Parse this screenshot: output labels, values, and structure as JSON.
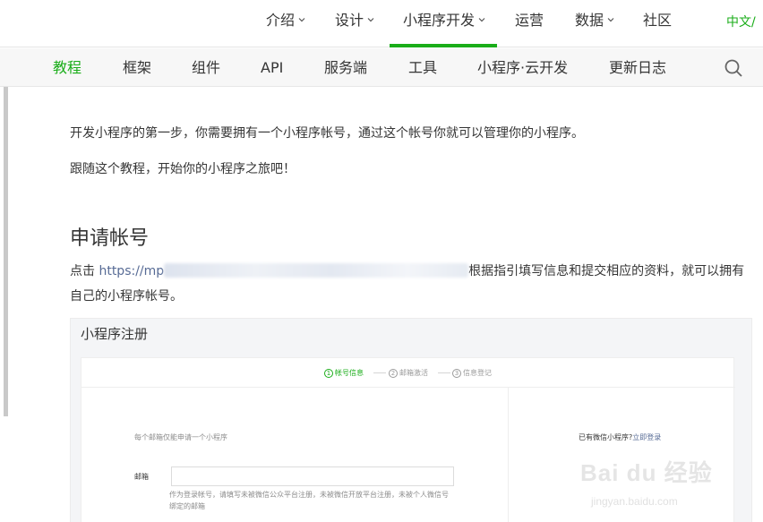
{
  "topnav": {
    "items": [
      {
        "label": "介绍",
        "has_dropdown": true
      },
      {
        "label": "设计",
        "has_dropdown": true
      },
      {
        "label": "小程序开发",
        "has_dropdown": true,
        "active": true
      },
      {
        "label": "运营",
        "has_dropdown": false
      },
      {
        "label": "数据",
        "has_dropdown": true
      },
      {
        "label": "社区",
        "has_dropdown": false
      }
    ],
    "language": "中文/",
    "accent_color": "#1aad19"
  },
  "subnav": {
    "items": [
      {
        "label": "教程",
        "active": true
      },
      {
        "label": "框架"
      },
      {
        "label": "组件"
      },
      {
        "label": "API"
      },
      {
        "label": "服务端"
      },
      {
        "label": "工具"
      },
      {
        "label": "小程序·云开发"
      },
      {
        "label": "更新日志"
      }
    ],
    "search_icon": "search-icon"
  },
  "content": {
    "intro_1": "开发小程序的第一步，你需要拥有一个小程序帐号，通过这个帐号你就可以管理你的小程序。",
    "intro_2": "跟随这个教程，开始你的小程序之旅吧！",
    "section_title": "申请帐号",
    "click_prefix": "点击 ",
    "link_visible": "https://mp",
    "after_link": "根据指引填写信息和提交相应的资料，就可以拥有",
    "line_2": "自己的小程序帐号。"
  },
  "panel": {
    "title": "小程序注册",
    "steps": [
      {
        "num": "1",
        "label": "帐号信息",
        "active": true
      },
      {
        "num": "2",
        "label": "邮箱激活"
      },
      {
        "num": "3",
        "label": "信息登记"
      }
    ],
    "hint": "每个邮箱仅能申请一个小程序",
    "has_wechat_prefix": "已有微信小程序?",
    "login_now": "立即登录",
    "email_label": "邮箱",
    "email_help_1": "作为登录帐号，请填写未被微信公众平台注册，未被微信开放平台注册，未被个人微信号",
    "email_help_2": "绑定的邮箱"
  },
  "watermark": {
    "brand": "Bai du 经验",
    "url": "jingyan.baidu.com"
  }
}
